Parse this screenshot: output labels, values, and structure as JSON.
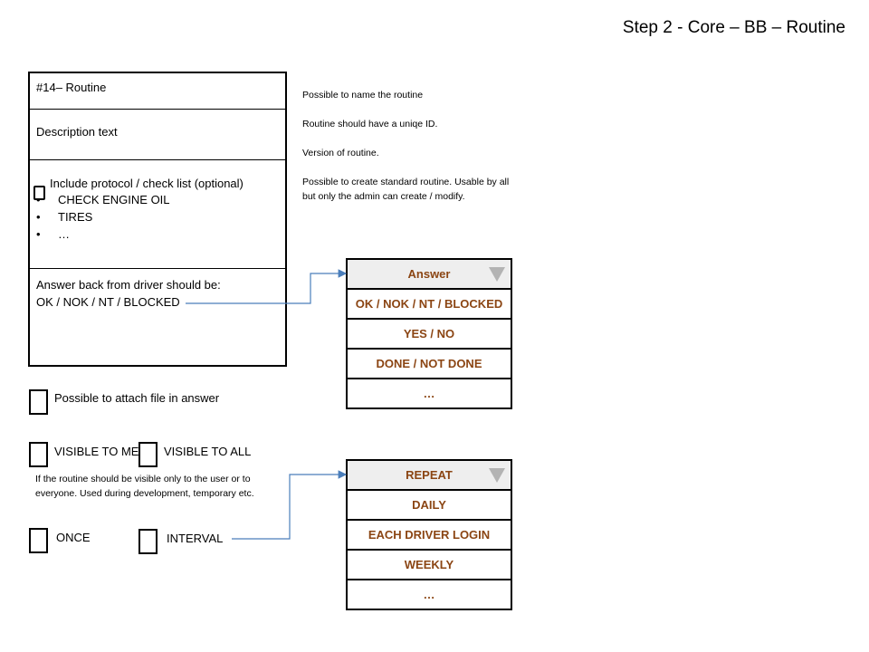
{
  "title": "Step 2 - Core – BB – Routine",
  "card": {
    "routine_title": "#14– Routine",
    "description": "Description text",
    "protocol_label": "Include protocol / check list (optional)",
    "checklist": [
      "CHECK ENGINE OIL",
      "TIRES",
      "…"
    ],
    "answer_line1": "Answer back from driver should be:",
    "answer_line2": "OK / NOK / NT / BLOCKED"
  },
  "notes": {
    "name": "Possible to name the routine",
    "id": "Routine should have a uniqe ID.",
    "version": "Version of routine.",
    "standard_line1": "Possible to create standard routine. Usable by all",
    "standard_line2": "but only the  admin can create / modify.",
    "visibility_line1": "If the routine should be visible only to the  user or to",
    "visibility_line2": "everyone.  Used during development,  temporary  etc."
  },
  "options": {
    "attach_file": "Possible to attach file in answer",
    "visible_to_me": "VISIBLE TO ME",
    "visible_to_all": "VISIBLE TO ALL",
    "once": "ONCE",
    "interval": "INTERVAL"
  },
  "answer_dropdown": {
    "header": "Answer",
    "items": [
      "OK / NOK / NT / BLOCKED",
      "YES / NO",
      "DONE / NOT DONE",
      "…"
    ]
  },
  "repeat_dropdown": {
    "header": "REPEAT",
    "items": [
      "DAILY",
      "EACH DRIVER LOGIN",
      "WEEKLY",
      "…"
    ]
  },
  "colors": {
    "dropdown_text": "#8b4513",
    "dropdown_header_bg": "#eeeeee",
    "connector": "#4a7ebb"
  }
}
